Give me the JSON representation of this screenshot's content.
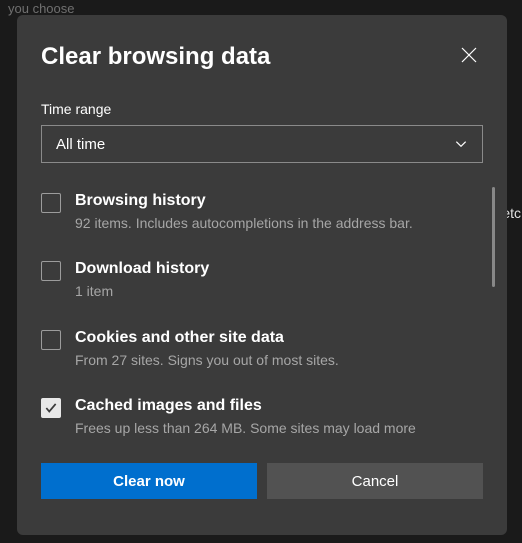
{
  "background": {
    "partial_text": "you choose",
    "etc_text": "etc"
  },
  "dialog": {
    "title": "Clear browsing data",
    "time_range": {
      "label": "Time range",
      "selected": "All time"
    },
    "options": [
      {
        "title": "Browsing history",
        "desc": "92 items. Includes autocompletions in the address bar.",
        "checked": false
      },
      {
        "title": "Download history",
        "desc": "1 item",
        "checked": false
      },
      {
        "title": "Cookies and other site data",
        "desc": "From 27 sites. Signs you out of most sites.",
        "checked": false
      },
      {
        "title": "Cached images and files",
        "desc": "Frees up less than 264 MB. Some sites may load more",
        "checked": true
      }
    ],
    "buttons": {
      "primary": "Clear now",
      "secondary": "Cancel"
    }
  }
}
